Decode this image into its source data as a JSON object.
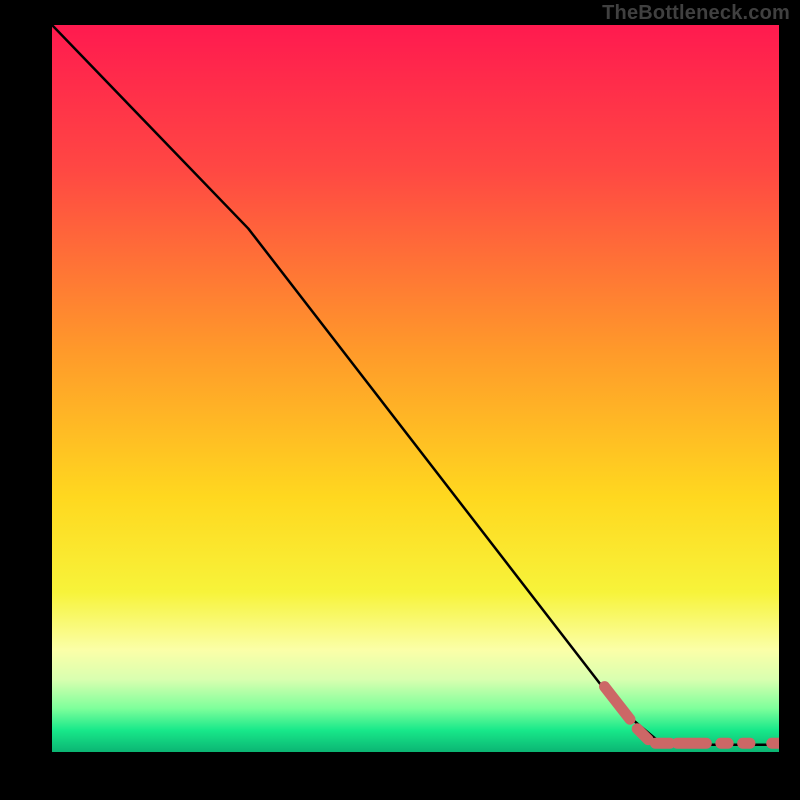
{
  "watermark": "TheBottleneck.com",
  "chart_data": {
    "type": "line",
    "title": "",
    "xlabel": "",
    "ylabel": "",
    "xlim": [
      0,
      100
    ],
    "ylim": [
      0,
      100
    ],
    "series": [
      {
        "name": "curve",
        "style": "solid-black",
        "points": [
          {
            "x": 0,
            "y": 100
          },
          {
            "x": 27,
            "y": 72
          },
          {
            "x": 78,
            "y": 6
          },
          {
            "x": 84,
            "y": 1
          },
          {
            "x": 100,
            "y": 1
          }
        ]
      },
      {
        "name": "dash-highlight",
        "style": "dashed-salmon",
        "segments": [
          {
            "x1": 76,
            "y1": 9,
            "x2": 79.5,
            "y2": 4.5
          },
          {
            "x1": 80.5,
            "y1": 3.2,
            "x2": 82,
            "y2": 1.7
          },
          {
            "x1": 83,
            "y1": 1.2,
            "x2": 85,
            "y2": 1.2
          },
          {
            "x1": 86,
            "y1": 1.2,
            "x2": 90,
            "y2": 1.2
          },
          {
            "x1": 92,
            "y1": 1.2,
            "x2": 93,
            "y2": 1.2
          },
          {
            "x1": 95,
            "y1": 1.2,
            "x2": 96,
            "y2": 1.2
          },
          {
            "x1": 99,
            "y1": 1.2,
            "x2": 100,
            "y2": 1.2
          }
        ]
      }
    ],
    "background_gradient": {
      "stops": [
        {
          "offset": 0,
          "color": "#ff1a4f"
        },
        {
          "offset": 20,
          "color": "#ff4843"
        },
        {
          "offset": 45,
          "color": "#ff9a2a"
        },
        {
          "offset": 65,
          "color": "#ffd81f"
        },
        {
          "offset": 78,
          "color": "#f7f33a"
        },
        {
          "offset": 86,
          "color": "#fbffa8"
        },
        {
          "offset": 90,
          "color": "#d9ffb0"
        },
        {
          "offset": 94,
          "color": "#7eff9b"
        },
        {
          "offset": 97,
          "color": "#18e88a"
        },
        {
          "offset": 100,
          "color": "#0bb573"
        }
      ]
    }
  }
}
